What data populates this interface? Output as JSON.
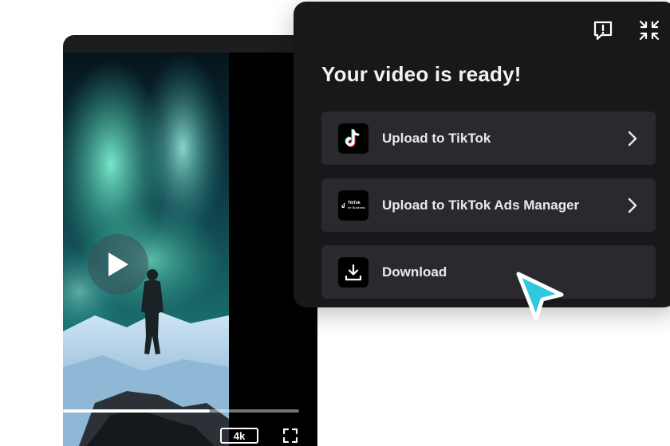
{
  "player": {
    "quality_label": "4k",
    "progress": 0.62
  },
  "panel": {
    "title": "Your video is ready!",
    "options": [
      {
        "label": "Upload to TikTok",
        "icon": "tiktok-logo-icon",
        "has_chevron": true
      },
      {
        "label": "Upload to TikTok Ads Manager",
        "icon": "tiktok-for-business-logo-icon",
        "has_chevron": true,
        "logo_text": "TikTok",
        "logo_subtext": "for Business"
      },
      {
        "label": "Download",
        "icon": "download-icon",
        "has_chevron": false
      }
    ]
  },
  "colors": {
    "panel_bg": "#18181b",
    "option_bg": "#2a2a2e",
    "cursor_accent": "#2ec9dc"
  }
}
